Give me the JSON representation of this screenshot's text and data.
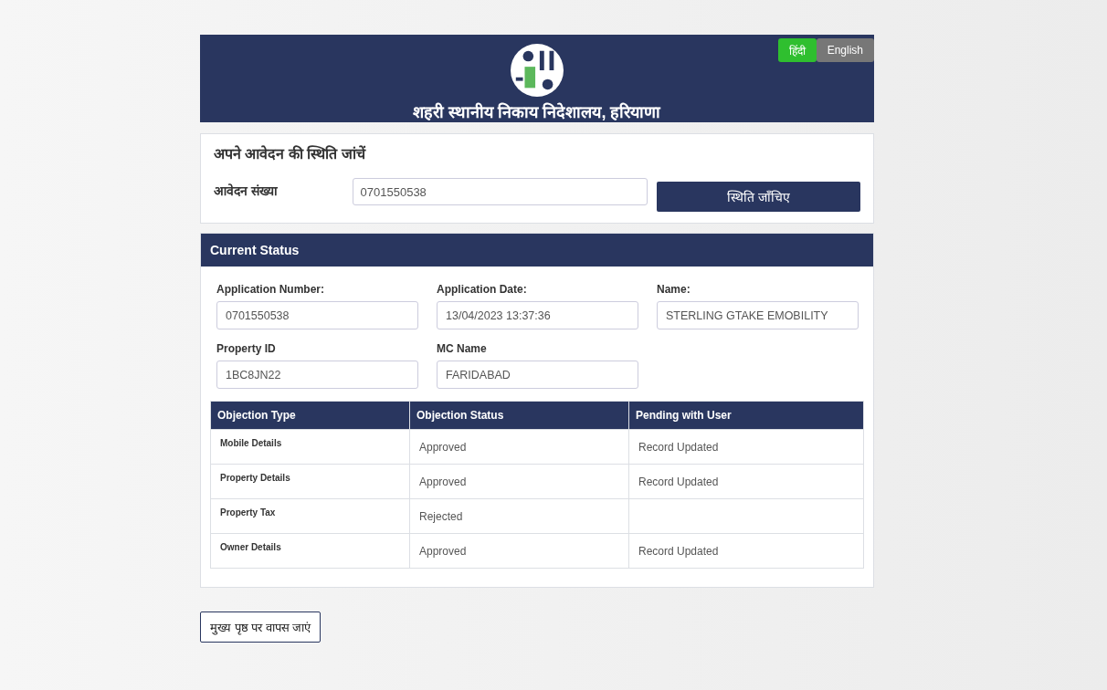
{
  "languages": [
    {
      "label": "हिंदी",
      "selected": true
    },
    {
      "label": "English",
      "selected": false
    }
  ],
  "header": {
    "title": "शहरी स्थानीय निकाय निदेशालय, हरियाणा"
  },
  "search": {
    "heading": "अपने आवेदन की स्थिति जांचें",
    "label": "आवेदन संख्या",
    "value": "0701550538",
    "button": "स्थिति जाँचिए"
  },
  "status": {
    "heading": "Current Status",
    "fields": [
      {
        "label": "Application Number:",
        "value": "0701550538"
      },
      {
        "label": "Application Date:",
        "value": "13/04/2023 13:37:36"
      },
      {
        "label": "Name:",
        "value": "STERLING GTAKE EMOBILITY"
      },
      {
        "label": "Property ID",
        "value": "1BC8JN22"
      },
      {
        "label": "MC Name",
        "value": "FARIDABAD"
      }
    ],
    "table": {
      "columns": [
        "Objection Type",
        "Objection Status",
        "Pending with User"
      ],
      "rows": [
        [
          "Mobile Details",
          "Approved",
          "Record Updated"
        ],
        [
          "Property Details",
          "Approved",
          "Record Updated"
        ],
        [
          "Property Tax",
          "Rejected",
          ""
        ],
        [
          "Owner Details",
          "Approved",
          "Record Updated"
        ]
      ]
    }
  },
  "back_button": "मुख्य पृष्ठ पर वापस जाएं"
}
